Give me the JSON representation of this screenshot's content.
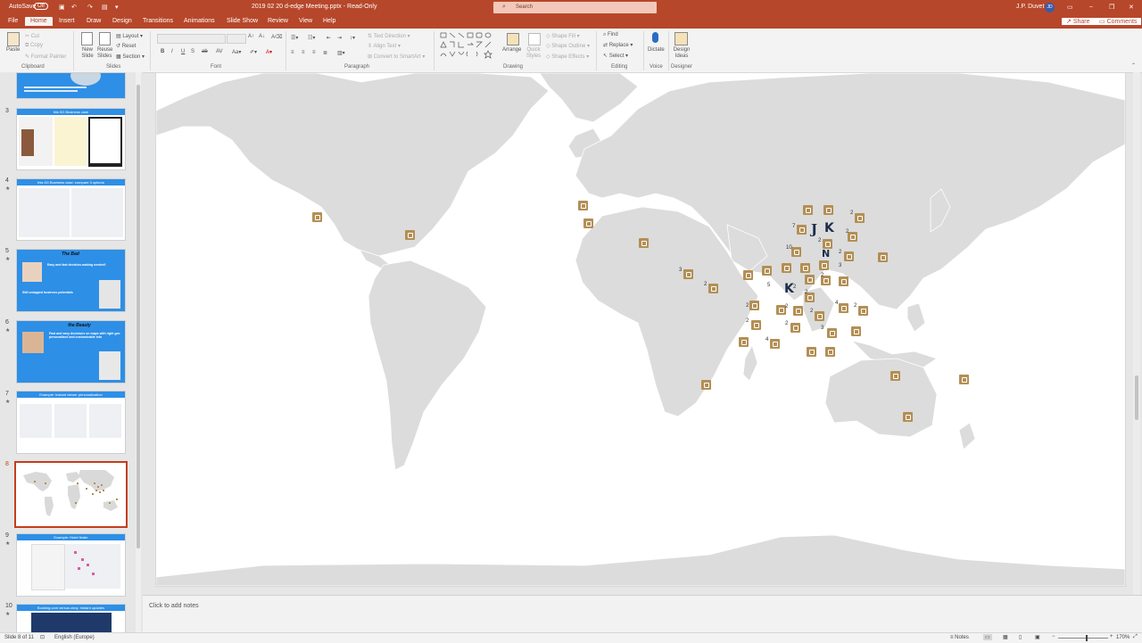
{
  "title_bar": {
    "autosave": "AutoSave",
    "autosave_state": "Off",
    "document": "2019 02 20 d-edge Meeting.pptx  -  Read-Only",
    "search_placeholder": "Search",
    "user_name": "J.P. Duvet",
    "user_initials": "JD"
  },
  "menu": {
    "tabs": [
      "File",
      "Home",
      "Insert",
      "Draw",
      "Design",
      "Transitions",
      "Animations",
      "Slide Show",
      "Review",
      "View",
      "Help"
    ],
    "active": "Home",
    "share": "Share",
    "comments": "Comments"
  },
  "ribbon": {
    "clipboard": {
      "paste": "Paste",
      "cut": "Cut",
      "copy": "Copy",
      "format_painter": "Format Painter",
      "group": "Clipboard"
    },
    "slides": {
      "new_slide": "New Slide",
      "reuse_slides": "Reuse Slides",
      "layout": "Layout",
      "reset": "Reset",
      "section": "Section",
      "group": "Slides"
    },
    "font": {
      "group": "Font"
    },
    "paragraph": {
      "text_direction": "Text Direction",
      "align_text": "Align Text",
      "convert": "Convert to SmartArt",
      "group": "Paragraph"
    },
    "drawing": {
      "arrange": "Arrange",
      "quick_styles": "Quick Styles",
      "shape_fill": "Shape Fill",
      "shape_outline": "Shape Outline",
      "shape_effects": "Shape Effects",
      "group": "Drawing"
    },
    "editing": {
      "find": "Find",
      "replace": "Replace",
      "select": "Select",
      "group": "Editing"
    },
    "voice": {
      "dictate": "Dictate",
      "group": "Voice"
    },
    "designer": {
      "design_ideas": "Design Ideas",
      "group": "Designer"
    }
  },
  "thumbnails": [
    {
      "number": "3",
      "title": "this 5G Business case"
    },
    {
      "number": "4",
      "title": "this 5G Business case: compare 3 options"
    },
    {
      "number": "5",
      "title": "The Bad",
      "line1": "Easy and fast decision-making needed!",
      "line2": "Still untapped business potentials"
    },
    {
      "number": "6",
      "title": "the Beauty",
      "line1": "Fast and easy decisions on maps with right geo personalized and customizable info"
    },
    {
      "number": "7",
      "title": "Example: Instant viewer personalization"
    },
    {
      "number": "8",
      "title": ""
    },
    {
      "number": "9",
      "title": "Example: Hotel finder"
    },
    {
      "number": "10",
      "title": "Booking.com versus ciroy: Instant updates"
    }
  ],
  "active_slide": "8",
  "map_counts": [
    "7",
    "2",
    "2",
    "2",
    "10",
    "2",
    "3",
    "3",
    "2",
    "2",
    "5",
    "2",
    "2",
    "2",
    "2",
    "4",
    "2",
    "2",
    "2",
    "4",
    "3",
    "2"
  ],
  "map_logos": [
    "J",
    "K",
    "N",
    "K"
  ],
  "notes_placeholder": "Click to add notes",
  "status": {
    "slide_info": "Slide 8 of 11",
    "language": "English (Europe)",
    "notes": "Notes",
    "zoom": "170%"
  },
  "colors": {
    "accent": "#b7472a",
    "pin": "#b38f55",
    "land": "#dcdcdc",
    "selected": "#c43e1c"
  }
}
